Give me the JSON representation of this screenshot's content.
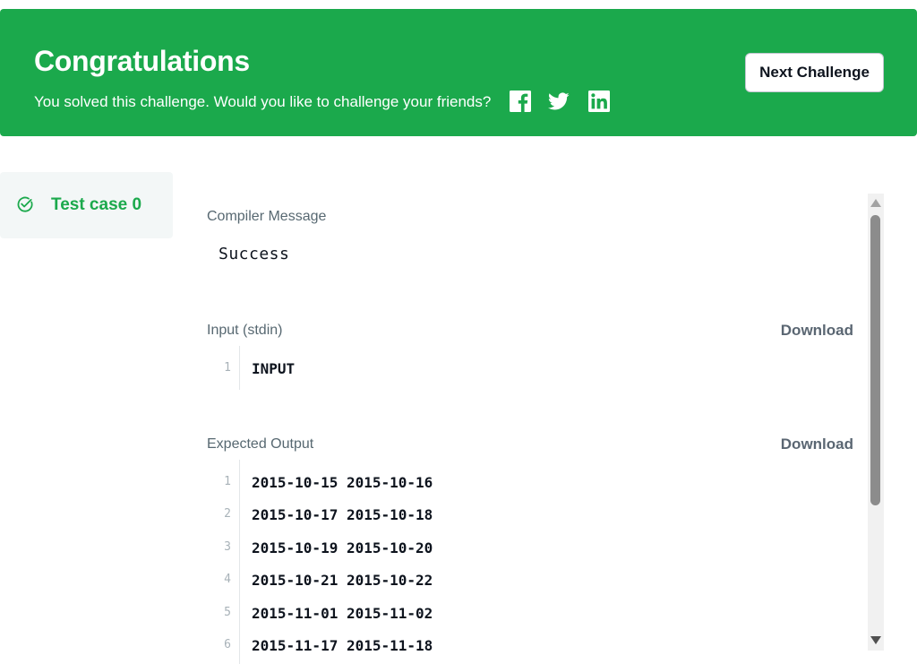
{
  "banner": {
    "title": "Congratulations",
    "subtitle": "You solved this challenge. Would you like to challenge your friends?",
    "share_icons": [
      "facebook-icon",
      "twitter-icon",
      "linkedin-icon"
    ],
    "next_button": "Next Challenge",
    "color": "#1ba94c"
  },
  "sidebar": {
    "test_case_label": "Test case 0",
    "status_icon": "check-circle-icon"
  },
  "compiler": {
    "label": "Compiler Message",
    "message": "Success"
  },
  "input": {
    "label": "Input (stdin)",
    "download": "Download",
    "lines": [
      {
        "num": "1",
        "text": "INPUT"
      }
    ]
  },
  "expected": {
    "label": "Expected Output",
    "download": "Download",
    "lines": [
      {
        "num": "1",
        "text": "2015-10-15 2015-10-16"
      },
      {
        "num": "2",
        "text": "2015-10-17 2015-10-18"
      },
      {
        "num": "3",
        "text": "2015-10-19 2015-10-20"
      },
      {
        "num": "4",
        "text": "2015-10-21 2015-10-22"
      },
      {
        "num": "5",
        "text": "2015-11-01 2015-11-02"
      },
      {
        "num": "6",
        "text": "2015-11-17 2015-11-18"
      }
    ]
  }
}
